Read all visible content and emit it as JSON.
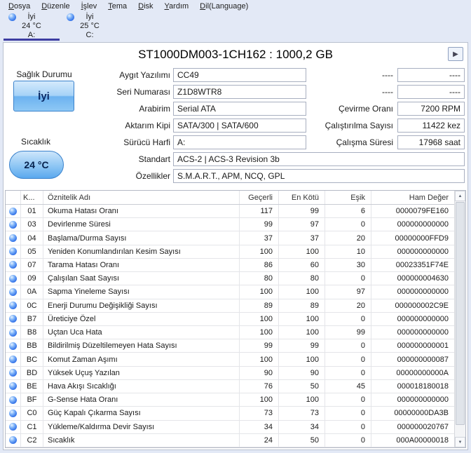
{
  "menu": {
    "items": [
      {
        "label": "Dosya"
      },
      {
        "label": "Düzenle"
      },
      {
        "label": "İşlev"
      },
      {
        "label": "Tema"
      },
      {
        "label": "Disk"
      },
      {
        "label": "Yardım"
      },
      {
        "label": "Dil(Language)"
      }
    ]
  },
  "drives": [
    {
      "status": "İyi",
      "temp": "24 °C",
      "letter": "A:",
      "selected": true
    },
    {
      "status": "İyi",
      "temp": "25 °C",
      "letter": "C:",
      "selected": false
    }
  ],
  "header": {
    "title": "ST1000DM003-1CH162 : 1000,2 GB",
    "play_icon": "▶"
  },
  "health": {
    "label": "Sağlık Durumu",
    "value": "İyi"
  },
  "temperature": {
    "label": "Sıcaklık",
    "value": "24 °C"
  },
  "info_left": [
    {
      "label": "Aygıt Yazılımı",
      "value": "CC49",
      "wide": false
    },
    {
      "label": "Seri Numarası",
      "value": "Z1D8WTR8",
      "wide": false
    },
    {
      "label": "Arabirim",
      "value": "Serial ATA",
      "wide": false
    },
    {
      "label": "Aktarım Kipi",
      "value": "SATA/300 | SATA/600",
      "wide": false
    },
    {
      "label": "Sürücü Harfi",
      "value": "A:",
      "wide": false
    },
    {
      "label": "Standart",
      "value": "ACS-2 | ACS-3 Revision 3b",
      "wide": true
    },
    {
      "label": "Özellikler",
      "value": "S.M.A.R.T., APM, NCQ, GPL",
      "wide": true
    }
  ],
  "info_right": [
    {
      "label": "----",
      "value": "----"
    },
    {
      "label": "----",
      "value": "----"
    },
    {
      "label": "Çevirme Oranı",
      "value": "7200 RPM"
    },
    {
      "label": "Çalıştırılma Sayısı",
      "value": "11422 kez"
    },
    {
      "label": "Çalışma Süresi",
      "value": "17968 saat"
    }
  ],
  "smart_table": {
    "headers": {
      "id": "K...",
      "name": "Öznitelik Adı",
      "current": "Geçerli",
      "worst": "En Kötü",
      "threshold": "Eşik",
      "raw": "Ham Değer"
    },
    "rows": [
      {
        "id": "01",
        "name": "Okuma Hatası Oranı",
        "current": "117",
        "worst": "99",
        "threshold": "6",
        "raw": "0000079FE160"
      },
      {
        "id": "03",
        "name": "Devirlenme Süresi",
        "current": "99",
        "worst": "97",
        "threshold": "0",
        "raw": "000000000000"
      },
      {
        "id": "04",
        "name": "Başlama/Durma Sayısı",
        "current": "37",
        "worst": "37",
        "threshold": "20",
        "raw": "00000000FFD9"
      },
      {
        "id": "05",
        "name": "Yeniden Konumlandırılan Kesim Sayısı",
        "current": "100",
        "worst": "100",
        "threshold": "10",
        "raw": "000000000000"
      },
      {
        "id": "07",
        "name": "Tarama Hatası Oranı",
        "current": "86",
        "worst": "60",
        "threshold": "30",
        "raw": "00023351F74E"
      },
      {
        "id": "09",
        "name": "Çalışılan Saat Sayısı",
        "current": "80",
        "worst": "80",
        "threshold": "0",
        "raw": "000000004630"
      },
      {
        "id": "0A",
        "name": "Sapma Yineleme Sayısı",
        "current": "100",
        "worst": "100",
        "threshold": "97",
        "raw": "000000000000"
      },
      {
        "id": "0C",
        "name": "Enerji Durumu Değişikliği Sayısı",
        "current": "89",
        "worst": "89",
        "threshold": "20",
        "raw": "000000002C9E"
      },
      {
        "id": "B7",
        "name": "Üreticiye Özel",
        "current": "100",
        "worst": "100",
        "threshold": "0",
        "raw": "000000000000"
      },
      {
        "id": "B8",
        "name": "Uçtan Uca Hata",
        "current": "100",
        "worst": "100",
        "threshold": "99",
        "raw": "000000000000"
      },
      {
        "id": "BB",
        "name": "Bildirilmiş Düzeltilemeyen Hata Sayısı",
        "current": "99",
        "worst": "99",
        "threshold": "0",
        "raw": "000000000001"
      },
      {
        "id": "BC",
        "name": "Komut Zaman Aşımı",
        "current": "100",
        "worst": "100",
        "threshold": "0",
        "raw": "000000000087"
      },
      {
        "id": "BD",
        "name": "Yüksek Uçuş Yazılan",
        "current": "90",
        "worst": "90",
        "threshold": "0",
        "raw": "00000000000A"
      },
      {
        "id": "BE",
        "name": "Hava Akışı Sıcaklığı",
        "current": "76",
        "worst": "50",
        "threshold": "45",
        "raw": "000018180018"
      },
      {
        "id": "BF",
        "name": "G-Sense Hata Oranı",
        "current": "100",
        "worst": "100",
        "threshold": "0",
        "raw": "000000000000"
      },
      {
        "id": "C0",
        "name": "Güç Kapalı Çıkarma Sayısı",
        "current": "73",
        "worst": "73",
        "threshold": "0",
        "raw": "00000000DA3B"
      },
      {
        "id": "C1",
        "name": "Yükleme/Kaldırma Devir Sayısı",
        "current": "34",
        "worst": "34",
        "threshold": "0",
        "raw": "000000020767"
      },
      {
        "id": "C2",
        "name": "Sıcaklık",
        "current": "24",
        "worst": "50",
        "threshold": "0",
        "raw": "000A00000018"
      }
    ]
  },
  "scrollbar": {
    "up": "▲",
    "down": "▼"
  },
  "colors": {
    "window_bg": "#e3e9f6",
    "status_good_blue": "#2f6fe8",
    "health_button_blue": "#6cb2f0",
    "selected_tab_underline": "#3d3da2"
  }
}
